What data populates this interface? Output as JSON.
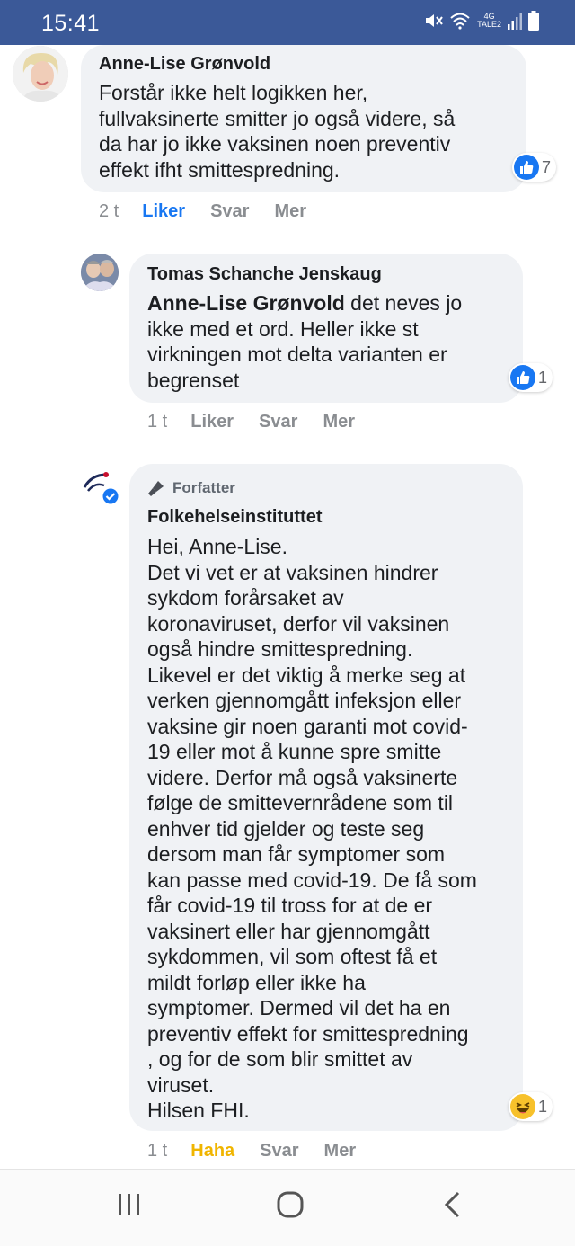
{
  "status_bar": {
    "time": "15:41",
    "network_label_top": "4G",
    "network_label_bottom": "TALE2"
  },
  "comments": [
    {
      "author": "Anne-Lise Grønvold",
      "text": "Forstår ikke helt logikken her,\nfullvaksinerte smitter jo også videre, så\nda har jo ikke vaksinen noen preventiv\neffekt ifht smittespredning.",
      "reaction_count": "7",
      "reaction_type": "like-icon",
      "time": "2 t",
      "like_label": "Liker",
      "reply_label": "Svar",
      "more_label": "Mer"
    },
    {
      "author": "Tomas Schanche Jenskaug",
      "mention": "Anne-Lise Grønvold",
      "text": " det neves jo\nikke med et ord. Heller ikke st\nvirkningen mot delta varianten er\nbegrenset",
      "reaction_count": "1",
      "reaction_type": "like-icon",
      "time": "1 t",
      "like_label": "Liker",
      "reply_label": "Svar",
      "more_label": "Mer"
    },
    {
      "badge": "Forfatter",
      "author": "Folkehelseinstituttet",
      "text": "Hei, Anne-Lise.\nDet vi vet er at vaksinen hindrer\nsykdom forårsaket av\nkoronaviruset, derfor vil vaksinen\nogså hindre smittespredning.\nLikevel er det viktig å merke seg at\nverken gjennomgått infeksjon eller\nvaksine gir noen garanti mot covid-\n19 eller mot å kunne spre smitte\nvidere. Derfor må også vaksinerte\nfølge de smittevernrådene som til\nenhver tid gjelder og teste seg\ndersom man får symptomer som\nkan passe med covid-19. De få som\nfår covid-19 til tross for at de er\nvaksinert eller har gjennomgått\nsykdommen, vil som oftest få et\nmildt forløp eller ikke ha\nsymptomer. Dermed vil det ha en\npreventiv effekt for smittespredning\n, og for de som blir smittet av\nviruset.\nHilsen FHI.",
      "reaction_count": "1",
      "reaction_type": "haha-icon",
      "time": "1 t",
      "like_label": "Haha",
      "reply_label": "Svar",
      "more_label": "Mer"
    }
  ],
  "colors": {
    "status_bar": "#3b5998",
    "bubble": "#f0f2f5",
    "like_blue": "#1877f2",
    "haha_yellow": "#f0b500"
  }
}
